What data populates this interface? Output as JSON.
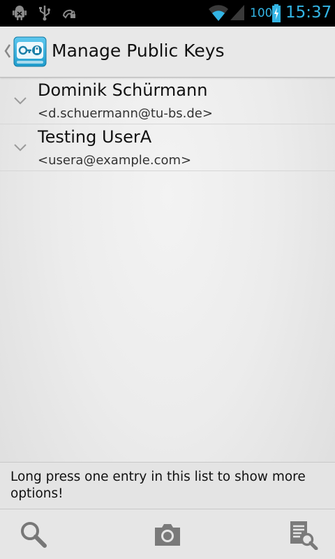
{
  "status_bar": {
    "icons": [
      "android-debug-icon",
      "usb-icon",
      "missed-call-icon",
      "wifi-icon",
      "signal-icon",
      "battery-charging-icon"
    ],
    "battery_percent": "100",
    "time": "15:37"
  },
  "action_bar": {
    "up_icon": "chevron-left-icon",
    "app_icon": "keys-app-icon",
    "title": "Manage Public Keys"
  },
  "keys": [
    {
      "name": "Dominik Schürmann",
      "email": "<d.schuermann@tu-bs.de>"
    },
    {
      "name": "Testing UserA",
      "email": "<usera@example.com>"
    }
  ],
  "hint": {
    "text": "Long press one entry in this list to show more options!"
  },
  "bottom_bar": {
    "actions": [
      "search-icon",
      "camera-icon",
      "key-search-icon"
    ]
  },
  "colors": {
    "accent": "#33b5e5",
    "status_bar_bg": "#000000",
    "text": "#111111"
  }
}
